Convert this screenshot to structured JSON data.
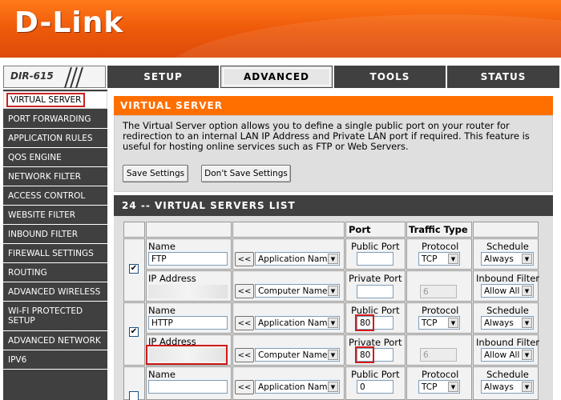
{
  "brand": {
    "logo": "D-Link",
    "model": "DIR-615"
  },
  "tabs": [
    {
      "label": "SETUP"
    },
    {
      "label": "ADVANCED"
    },
    {
      "label": "TOOLS"
    },
    {
      "label": "STATUS"
    }
  ],
  "sidebar": {
    "items": [
      {
        "label": "VIRTUAL SERVER"
      },
      {
        "label": "PORT FORWARDING"
      },
      {
        "label": "APPLICATION RULES"
      },
      {
        "label": "QOS ENGINE"
      },
      {
        "label": "NETWORK FILTER"
      },
      {
        "label": "ACCESS CONTROL"
      },
      {
        "label": "WEBSITE FILTER"
      },
      {
        "label": "INBOUND FILTER"
      },
      {
        "label": "FIREWALL SETTINGS"
      },
      {
        "label": "ROUTING"
      },
      {
        "label": "ADVANCED WIRELESS"
      },
      {
        "label": "WI-FI PROTECTED SETUP"
      },
      {
        "label": "ADVANCED NETWORK"
      },
      {
        "label": "IPV6"
      }
    ]
  },
  "virtual_server": {
    "title": "VIRTUAL SERVER",
    "description": "The Virtual Server option allows you to define a single public port on your router for redirection to an internal LAN IP Address and Private LAN port if required. This feature is useful for hosting online services such as FTP or Web Servers.",
    "save_label": "Save Settings",
    "dont_save_label": "Don't Save Settings"
  },
  "list": {
    "title": "24 -- VIRTUAL SERVERS LIST",
    "headers": {
      "port": "Port",
      "traffic_type": "Traffic Type"
    },
    "labels": {
      "name": "Name",
      "ip_address": "IP Address",
      "public_port": "Public Port",
      "private_port": "Private Port",
      "protocol": "Protocol",
      "schedule": "Schedule",
      "inbound_filter": "Inbound Filter",
      "arrow_button": "<<",
      "application_name": "Application Name",
      "computer_name": "Computer Name"
    },
    "rows": [
      {
        "checked": true,
        "name": "FTP",
        "ip": "",
        "public_port": "",
        "private_port": "",
        "protocol": "TCP",
        "protocol_number": "6",
        "schedule": "Always",
        "inbound_filter": "Allow All"
      },
      {
        "checked": true,
        "name": "HTTP",
        "ip": "",
        "public_port": "80",
        "private_port": "80",
        "protocol": "TCP",
        "protocol_number": "6",
        "schedule": "Always",
        "inbound_filter": "Allow All"
      },
      {
        "checked": false,
        "name": "",
        "ip": "",
        "public_port": "0",
        "private_port": "",
        "protocol": "TCP",
        "protocol_number": "",
        "schedule": "Always",
        "inbound_filter": ""
      }
    ]
  },
  "colors": {
    "orange": "#ff6f00",
    "dark": "#404040",
    "highlight": "#d21a1a"
  }
}
